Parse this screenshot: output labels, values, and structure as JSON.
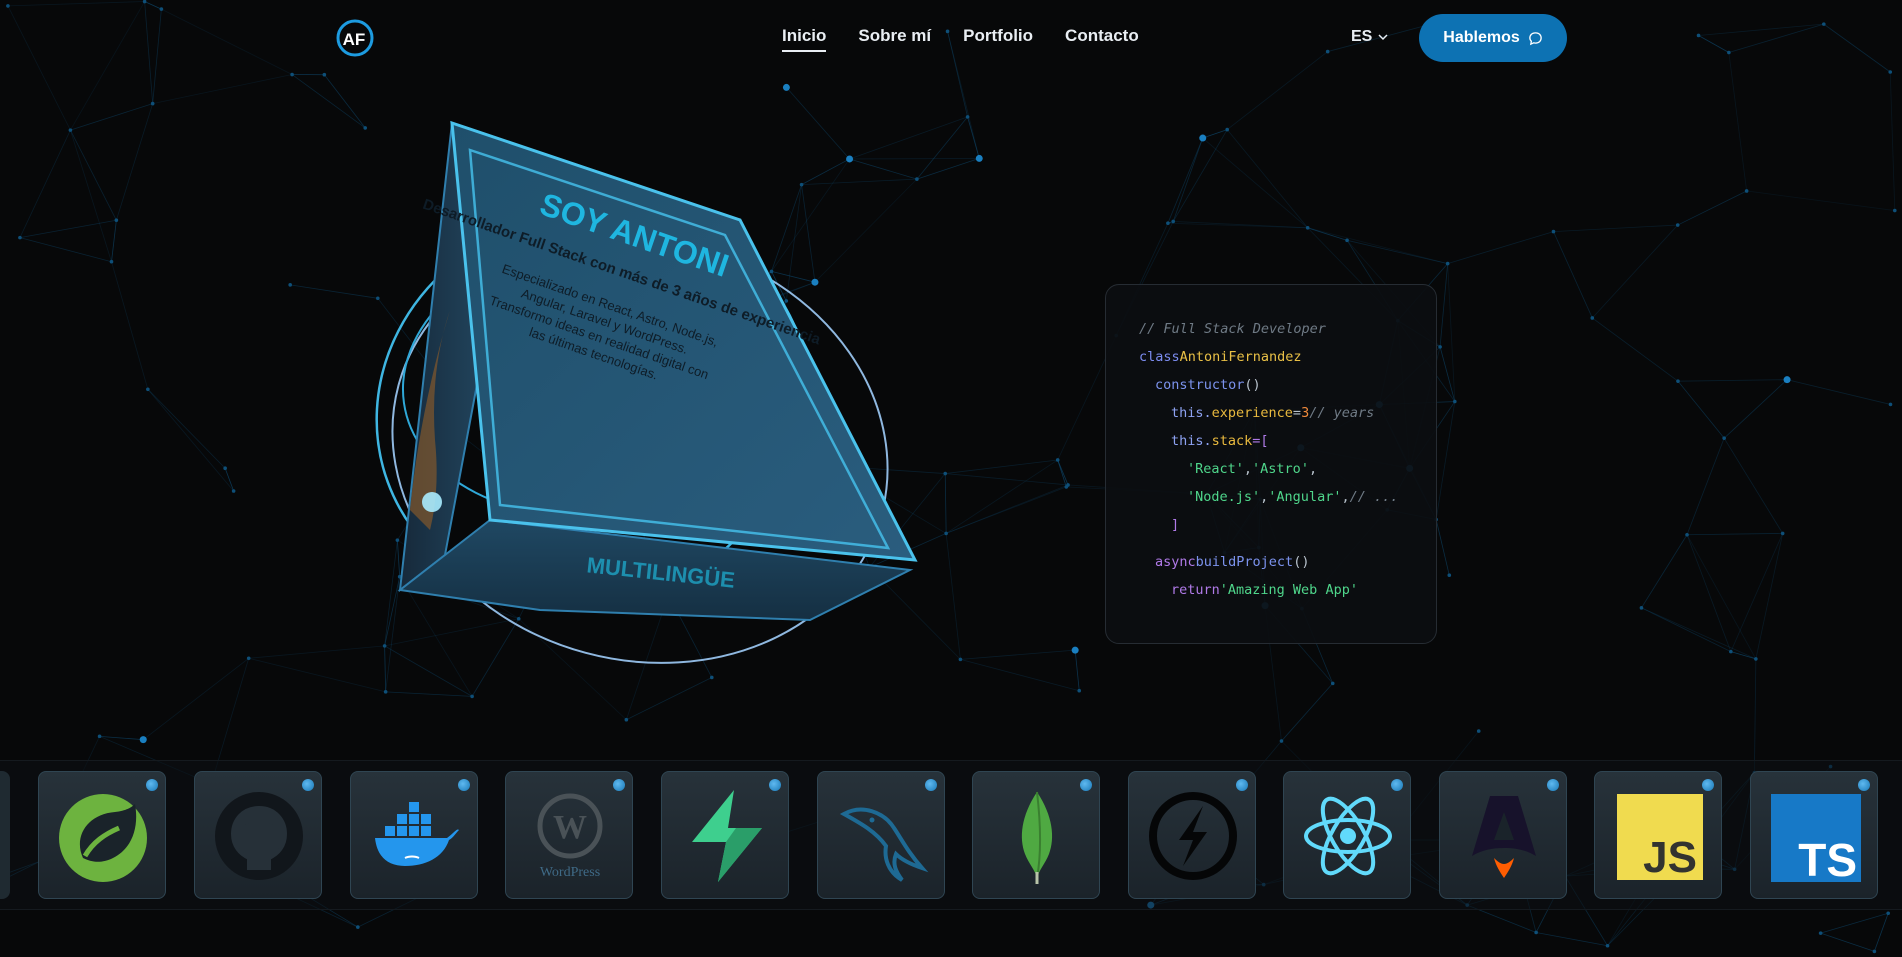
{
  "header": {
    "logo_text": "AF",
    "nav": [
      {
        "label": "Inicio",
        "active": true
      },
      {
        "label": "Sobre mí",
        "active": false
      },
      {
        "label": "Portfolio",
        "active": false
      },
      {
        "label": "Contacto",
        "active": false
      }
    ],
    "lang_label": "ES",
    "cta_label": "Hablemos"
  },
  "hero": {
    "cube_title": "SOY ANTONI",
    "cube_subtitle": "Desarrollador Full Stack con más de 3 años de experiencia",
    "cube_desc_1": "Especializado en React, Astro, Node.js,",
    "cube_desc_2": "Angular, Laravel y WordPress.",
    "cube_desc_3": "Transformo ideas en realidad digital con",
    "cube_desc_4": "las últimas tecnologías.",
    "cube_bottom_text": "MULTILINGÜE"
  },
  "code": {
    "comment": "// Full Stack Developer",
    "class_kw": "class",
    "class_name": "AntoniFernandez",
    "constructor": "constructor",
    "parens": "()",
    "this1": "this.",
    "prop1": "experience",
    "eq": "=",
    "num": "3",
    "comment2": "// years",
    "this2": "this.",
    "prop2": "stack",
    "eq_bracket": "=[",
    "s1": "'React'",
    "comma": ",",
    "s2": "'Astro'",
    "s3": "'Node.js'",
    "s4": "'Angular'",
    "comment3": "// ...",
    "close_bracket": "]",
    "async_kw": "async",
    "method": "buildProject",
    "return_kw": "return",
    "ret_str": "'Amazing Web App'"
  },
  "tech_icons": [
    {
      "icon": "spring-icon"
    },
    {
      "icon": "github-icon"
    },
    {
      "icon": "docker-icon"
    },
    {
      "icon": "wordpress-icon",
      "label": "WordPress"
    },
    {
      "icon": "supabase-icon"
    },
    {
      "icon": "mysql-icon"
    },
    {
      "icon": "mongodb-icon"
    },
    {
      "icon": "socketio-icon"
    },
    {
      "icon": "react-icon"
    },
    {
      "icon": "astro-icon"
    },
    {
      "icon": "javascript-icon",
      "label": "JS"
    },
    {
      "icon": "typescript-icon",
      "label": "TS"
    }
  ],
  "colors": {
    "background": "#070809",
    "accent": "#0d72b3",
    "network_line": "#0e4f78",
    "cube_glow": "#37b6e6"
  }
}
